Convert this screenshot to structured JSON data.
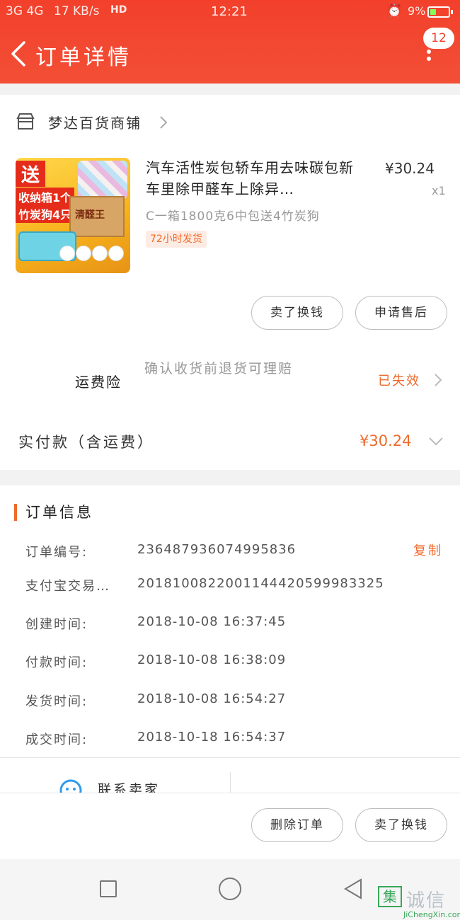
{
  "status_bar": {
    "network": "3G 4G",
    "speed": "17 KB/s",
    "hd": "HD",
    "time": "12:21",
    "battery": "9%"
  },
  "header": {
    "title": "订单详情",
    "badge_count": "12"
  },
  "shop": {
    "name": "梦达百货商铺"
  },
  "item": {
    "title": "汽车活性炭包轿车用去味碳包新车里除甲醛车上除异…",
    "price": "¥30.24",
    "quantity": "x1",
    "sku": "C一箱1800克6中包送4竹炭狗",
    "ship_tag": "72小时发货",
    "thumb": {
      "send": "送",
      "line1": "收纳箱1个",
      "line2": "竹炭狗4只",
      "brand": "清醛王"
    }
  },
  "item_buttons": {
    "refund": "卖了换钱",
    "aftersale": "申请售后"
  },
  "insurance": {
    "label": "运费险",
    "description": "确认收货前退货可理赔",
    "status": "已失效"
  },
  "payment": {
    "label": "实付款（含运费）",
    "amount": "¥30.24"
  },
  "order_info": {
    "section_title": "订单信息",
    "copy_label": "复制",
    "rows": [
      {
        "label": "订单编号:",
        "value": "236487936074995836"
      },
      {
        "label": "支付宝交易…",
        "value": "2018100822001144420599983325"
      },
      {
        "label": "创建时间:",
        "value": "2018-10-08 16:37:45"
      },
      {
        "label": "付款时间:",
        "value": "2018-10-08 16:38:09"
      },
      {
        "label": "发货时间:",
        "value": "2018-10-08 16:54:27"
      },
      {
        "label": "成交时间:",
        "value": "2018-10-18 16:54:37"
      }
    ]
  },
  "contact": {
    "label": "联系卖家"
  },
  "action_bar": {
    "delete": "删除订单",
    "refund": "卖了换钱"
  },
  "watermark": {
    "mark": "集",
    "cn": "诚信",
    "en": "JiChengXin.com"
  },
  "colors": {
    "header_red": "#f2402b",
    "accent_orange": "#ef6a2b"
  }
}
